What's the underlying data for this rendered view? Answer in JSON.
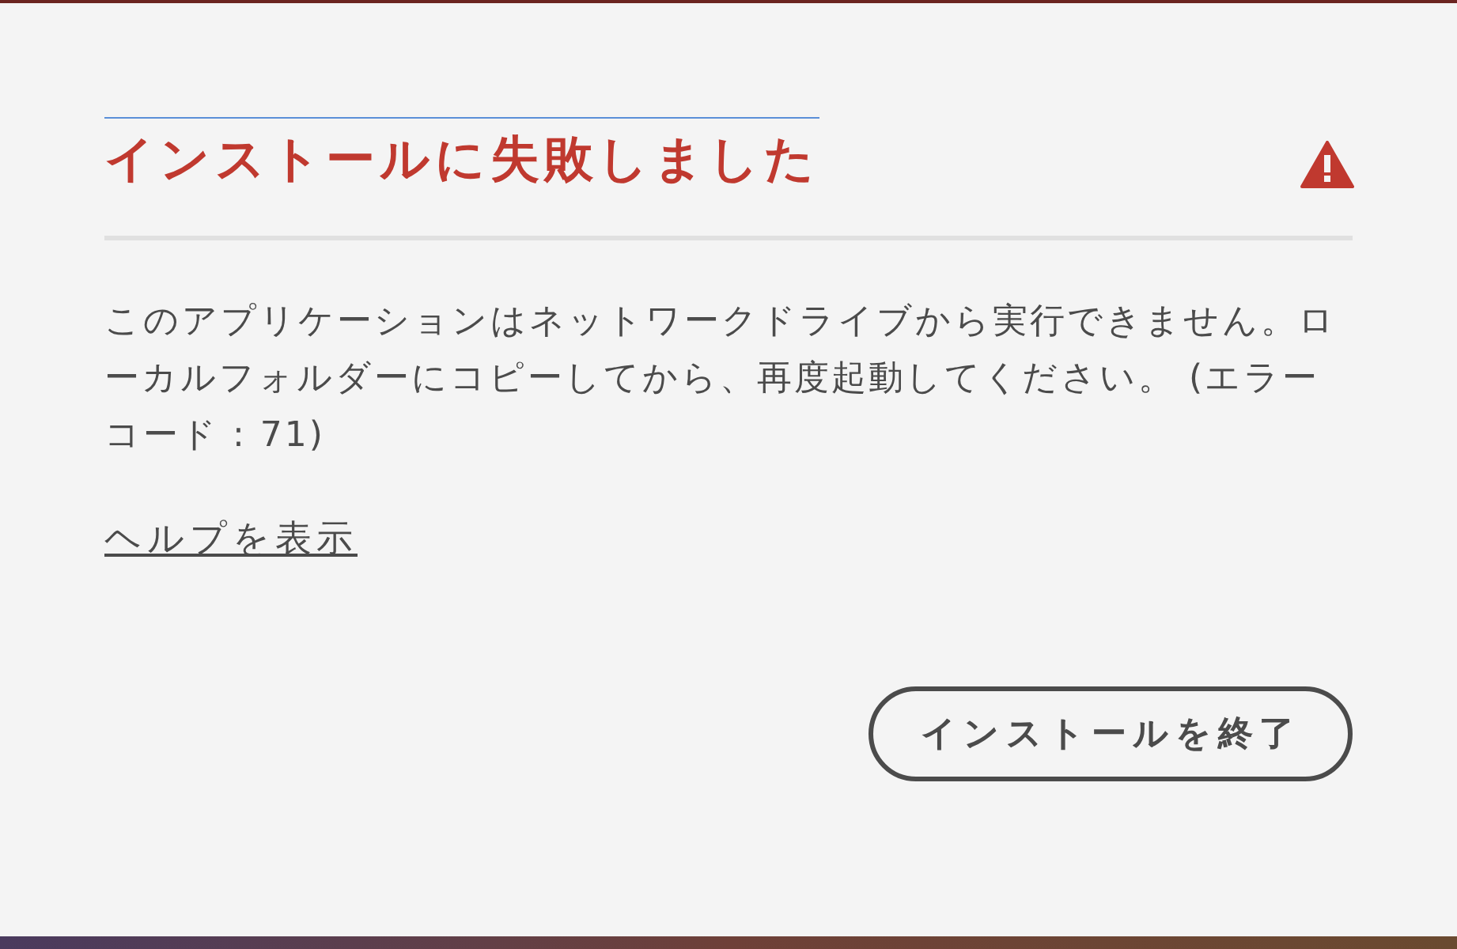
{
  "dialog": {
    "title": "インストールに失敗しました",
    "message": "このアプリケーションはネットワークドライブから実行できません。ローカルフォルダーにコピーしてから、再度起動してください。 (エラーコード : 71)",
    "help_link": "ヘルプを表示",
    "buttons": [
      "インストールを終了"
    ]
  }
}
